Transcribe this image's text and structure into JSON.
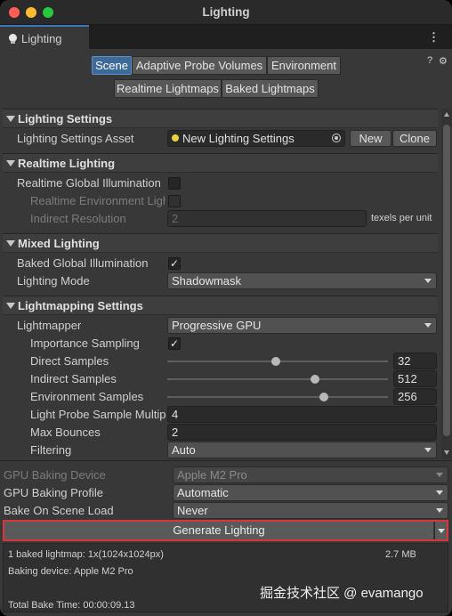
{
  "window": {
    "title": "Lighting"
  },
  "tab": {
    "label": "Lighting",
    "icon": "lightbulb-icon"
  },
  "toolbar": {
    "row1": [
      "Scene",
      "Adaptive Probe Volumes",
      "Environment"
    ],
    "row2": [
      "Realtime Lightmaps",
      "Baked Lightmaps"
    ],
    "active": "Scene",
    "help_icon": "?",
    "settings_icon": "⚙"
  },
  "lighting_settings": {
    "header": "Lighting Settings",
    "asset_label": "Lighting Settings Asset",
    "asset_value": "New Lighting Settings",
    "new_button": "New",
    "clone_button": "Clone"
  },
  "realtime_lighting": {
    "header": "Realtime Lighting",
    "gi_label": "Realtime Global Illumination",
    "gi_checked": false,
    "env_label": "Realtime Environment Ligh",
    "env_checked": false,
    "indirect_label": "Indirect Resolution",
    "indirect_value": "2",
    "indirect_unit": "texels per unit"
  },
  "mixed_lighting": {
    "header": "Mixed Lighting",
    "baked_gi_label": "Baked Global Illumination",
    "baked_gi_checked": true,
    "mode_label": "Lighting Mode",
    "mode_value": "Shadowmask"
  },
  "lightmapping": {
    "header": "Lightmapping Settings",
    "lightmapper_label": "Lightmapper",
    "lightmapper_value": "Progressive GPU",
    "importance_label": "Importance Sampling",
    "importance_checked": true,
    "direct_label": "Direct Samples",
    "direct_value": "32",
    "direct_fraction": 0.49,
    "indirect_label": "Indirect Samples",
    "indirect_value": "512",
    "indirect_fraction": 0.67,
    "env_label": "Environment Samples",
    "env_value": "256",
    "env_fraction": 0.71,
    "probe_label": "Light Probe Sample Multipl",
    "probe_value": "4",
    "bounces_label": "Max Bounces",
    "bounces_value": "2",
    "filtering_label": "Filtering",
    "filtering_value": "Auto"
  },
  "gpu": {
    "device_label": "GPU Baking Device",
    "device_value": "Apple M2 Pro",
    "profile_label": "GPU Baking Profile",
    "profile_value": "Automatic",
    "bake_label": "Bake On Scene Load",
    "bake_value": "Never"
  },
  "generate": {
    "label": "Generate Lighting"
  },
  "stats": {
    "lightmap_line": "1 baked lightmap: 1x(1024x1024px)",
    "size": "2.7 MB",
    "device_line": "Baking device: Apple M2 Pro",
    "total_line": "Total Bake Time: 00:00:09.13"
  },
  "watermark": "掘金技术社区 @ evamango"
}
